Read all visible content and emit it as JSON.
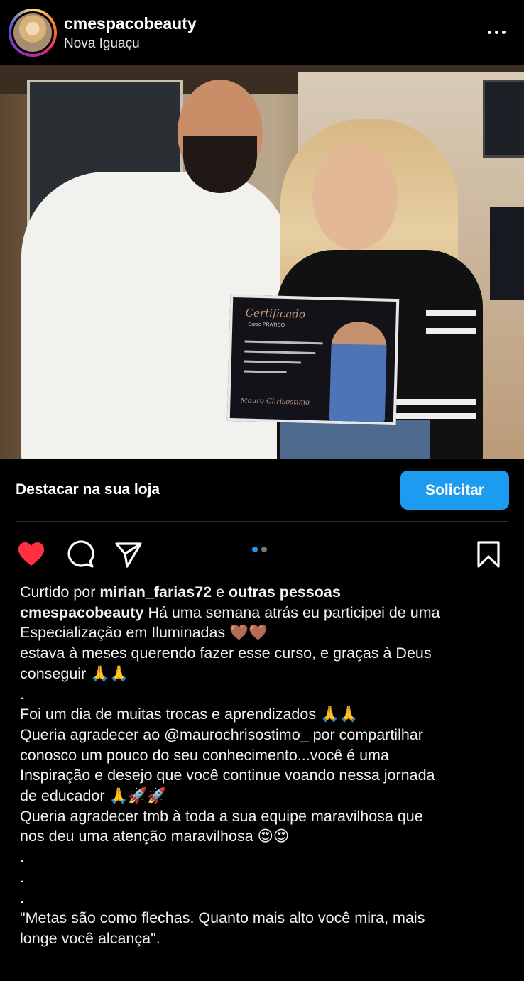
{
  "header": {
    "username": "cmespacobeauty",
    "location": "Nova Iguaçu",
    "more_icon": "more-horizontal-icon"
  },
  "photo": {
    "certificate_title": "Certificado",
    "certificate_subtitle": "Curso PRÁTICO",
    "certificate_signature": "Mauro Chrisostimo",
    "user_tag_icon": "person-icon"
  },
  "shop": {
    "label": "Destacar na sua loja",
    "button": "Solicitar"
  },
  "actions": {
    "like_icon": "heart-filled-icon",
    "comment_icon": "comment-icon",
    "share_icon": "send-icon",
    "save_icon": "bookmark-icon",
    "carousel_count": 2,
    "carousel_active": 1,
    "like_color": "#ff3040",
    "accent": "#1d9bf0"
  },
  "likes": {
    "prefix": "Curtido por",
    "user": "mirian_farias72",
    "joiner": "e",
    "others": "outras pessoas"
  },
  "caption": {
    "author": "cmespacobeauty",
    "lines": [
      "Há uma semana atrás eu participei de uma",
      "Especialização em Iluminadas 🤎🤎",
      "estava à meses querendo fazer esse curso, e graças à Deus",
      "conseguir 🙏🙏",
      ".",
      " Foi um dia de muitas trocas e aprendizados 🙏🙏",
      "Queria agradecer ao @maurochrisostimo_  por compartilhar",
      "conosco um pouco do seu conhecimento...você é uma",
      "Inspiração e desejo que você continue voando nessa jornada",
      "de educador 🙏🚀🚀",
      "Queria agradecer tmb à toda a sua equipe maravilhosa que",
      "nos deu uma atenção maravilhosa 😍😍",
      ".",
      ".",
      ".",
      "\"Metas são como flechas. Quanto mais alto você mira, mais",
      "longe você alcança\"."
    ]
  }
}
